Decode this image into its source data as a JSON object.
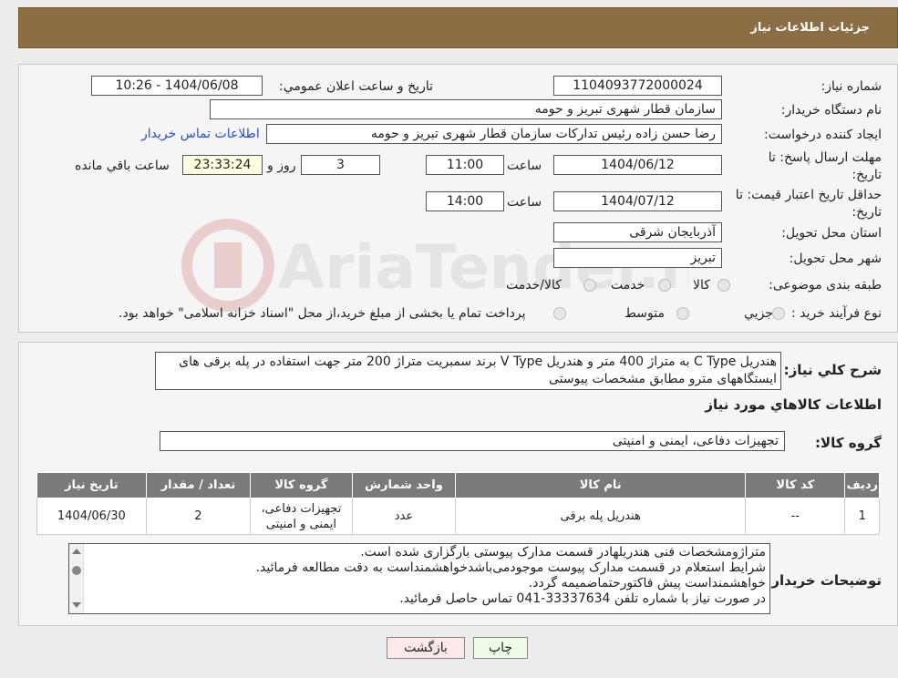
{
  "header": {
    "title": "جزئیات اطلاعات نیاز"
  },
  "watermark": {
    "text": "AriaTender.neT"
  },
  "form": {
    "need_number_label": "شماره نیاز:",
    "need_number": "1104093772000024",
    "announce_label": "تاریخ و ساعت اعلان عمومي:",
    "announce_value": "1404/06/08 - 10:26",
    "buyer_org_label": "نام دستگاه خریدار:",
    "buyer_org": "سازمان قطار شهری تبریز و حومه",
    "creator_label": "ایجاد کننده درخواست:",
    "creator": "رضا حسن زاده رئیس تدارکات سازمان قطار شهری تبریز و حومه",
    "contact_link": "اطلاعات تماس خریدار",
    "deadline_label": "مهلت ارسال پاسخ: تا تاریخ:",
    "deadline_date": "1404/06/12",
    "time_label": "ساعت",
    "deadline_time": "11:00",
    "days_value": "3",
    "days_label": "روز و",
    "remaining_value": "23:33:24",
    "remaining_label": "ساعت باقي مانده",
    "validity_label": "حداقل تاریخ اعتبار قیمت: تا تاریخ:",
    "validity_date": "1404/07/12",
    "validity_time": "14:00",
    "province_label": "استان محل تحویل:",
    "province": "آذربایجان شرقی",
    "city_label": "شهر محل تحویل:",
    "city": "تبریز",
    "category_label": "طبقه بندی موضوعی:",
    "category_options": [
      "کالا",
      "خدمت",
      "کالا/خدمت"
    ],
    "process_label": "نوع فرآیند خرید :",
    "process_options": [
      "جزیي",
      "متوسط"
    ],
    "payment_note": "پرداخت تمام یا بخشی از مبلغ خرید،از محل \"اسناد خزانه اسلامی\" خواهد بود."
  },
  "summary": {
    "label": "شرح كلي نياز:",
    "text": "هندریل C Type به متراژ 400 متر و هندریل V Type برند سمبریت متراژ 200 متر جهت استفاده در پله برقی های ایستگاههای مترو مطابق مشخصات پیوستی"
  },
  "goods": {
    "section_title": "اطلاعات كالاهاي مورد نياز",
    "group_label": "گروه كالا:",
    "group_value": "تجهیزات دفاعی، ایمنی و امنیتی",
    "columns": [
      "رديف",
      "كد كالا",
      "نام كالا",
      "واحد شمارش",
      "گروه كالا",
      "تعداد / مقدار",
      "تاريخ نياز"
    ],
    "rows": [
      {
        "index": "1",
        "code": "--",
        "name": "هندریل پله برقی",
        "unit": "عدد",
        "group": "تجهیزات دفاعی، ایمنی و امنیتی",
        "qty": "2",
        "date": "1404/06/30"
      }
    ]
  },
  "buyer_notes": {
    "label": "توضيحات خريدار:",
    "lines": [
      "متراژومشخصات فنی هندریلهادر قسمت مدارک پیوستی بارگزاری شده است.",
      "شرایط استعلام در قسمت مدارک پیوست موجودمی‌باشدخواهشمنداست به دقت مطالعه فرمائید.",
      "خواهشمنداست پیش فاکتورحتماضمیمه گردد.",
      "در صورت نیاز با شماره تلفن 33337634-041 تماس حاصل فرمائید."
    ]
  },
  "buttons": {
    "print": "چاپ",
    "back": "بازگشت"
  }
}
